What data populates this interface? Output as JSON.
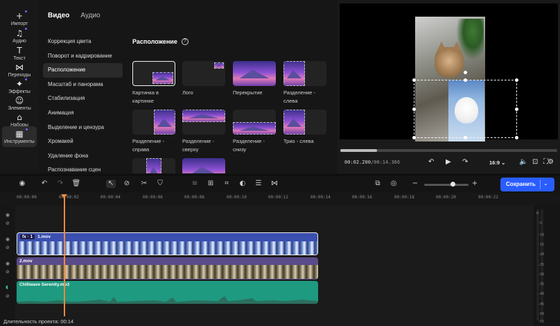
{
  "rail": {
    "items": [
      {
        "icon": "+",
        "label": "Импорт"
      },
      {
        "icon": "♫",
        "label": "Аудио"
      },
      {
        "icon": "T",
        "label": "Текст"
      },
      {
        "icon": "⋈",
        "label": "Переходы"
      },
      {
        "icon": "✦",
        "label": "Эффекты"
      },
      {
        "icon": "☺",
        "label": "Элементы"
      },
      {
        "icon": "⌂",
        "label": "Наборы"
      },
      {
        "icon": "▦",
        "label": "Инструменты"
      }
    ]
  },
  "panel": {
    "tabs": [
      "Видео",
      "Аудио"
    ],
    "menu": [
      "Коррекция цвета",
      "Поворот и кадрирование",
      "Расположение",
      "Масштаб и панорама",
      "Стабилизация",
      "Анимация",
      "Выделение и цензура",
      "Хромакей",
      "Удаление фона",
      "Распознавание сцен"
    ],
    "section_title": "Расположение",
    "layouts": [
      "Картинка в картинке",
      "Лого",
      "Перекрытие",
      "Разделение - слева",
      "Разделение - справа",
      "Разделение - сверху",
      "Разделение - снизу",
      "Трио - слева"
    ]
  },
  "preview": {
    "time_current": "00:02.200",
    "time_total": "/00:14.366",
    "aspect_ratio": "16:9",
    "progress": 0.17
  },
  "toolbar": {
    "save_label": "Сохранить"
  },
  "ruler": {
    "ticks": [
      "00:00:00",
      "00:00:02",
      "00:00:04",
      "00:00:06",
      "00:00:08",
      "00:00:10",
      "00:00:12",
      "00:00:14",
      "00:00:16",
      "00:00:18",
      "00:00:20",
      "00:00:22"
    ]
  },
  "clips": {
    "clip1_fx": "fx · 1",
    "clip1_name": "1.mov",
    "clip2_name": "2.mov",
    "clip3_name": "Chillwave Serenity.mp3"
  },
  "meter": {
    "db_labels": [
      "0",
      "-5",
      "-10",
      "-15",
      "-20",
      "-25",
      "-30",
      "-35",
      "-40",
      "-45",
      "-50",
      "-55"
    ]
  },
  "footer": {
    "duration": "Длительность проекта: 00:14"
  }
}
